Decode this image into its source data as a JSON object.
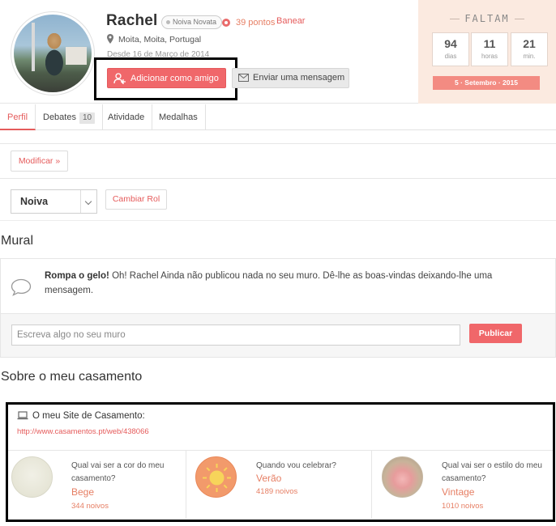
{
  "profile": {
    "name": "Rachel",
    "badge": "Noiva Novata",
    "points": "39 pontos",
    "ban": "Banear",
    "location": "Moita, Moita, Portugal",
    "since": "Desde 16 de Março de 2014"
  },
  "actions": {
    "add_friend": "Adicionar como amigo",
    "send_message": "Enviar uma mensagem"
  },
  "countdown": {
    "title": "FALTAM",
    "days": "94",
    "days_label": "dias",
    "hours": "11",
    "hours_label": "horas",
    "minutes": "21",
    "minutes_label": "min.",
    "date": "5 · Setembro · 2015"
  },
  "tabs": [
    {
      "label": "Perfil"
    },
    {
      "label": "Debates",
      "count": "10"
    },
    {
      "label": "Atividade"
    },
    {
      "label": "Medalhas"
    }
  ],
  "controls": {
    "modify": "Modificar »",
    "role_selected": "Noiva",
    "change_role": "Cambiar Rol"
  },
  "mural": {
    "title": "Mural",
    "notice_bold": "Rompa o gelo!",
    "notice_text": " Oh! Rachel Ainda não publicou nada no seu muro. Dê-lhe as boas-vindas deixando-lhe uma mensagem.",
    "input_placeholder": "Escreva algo no seu muro",
    "publish": "Publicar"
  },
  "wedding": {
    "title": "Sobre o meu casamento",
    "site_label": "O meu Site de Casamento:",
    "site_url": "http://www.casamentos.pt/web/438066",
    "items": [
      {
        "question": "Qual vai ser a cor do meu casamento?",
        "answer": "Bege",
        "count": "344 noivos"
      },
      {
        "question": "Quando vou celebrar?",
        "answer": "Verão",
        "count": "4189 noivos"
      },
      {
        "question": "Qual vai ser o estilo do meu casamento?",
        "answer": "Vintage",
        "count": "1010 noivos"
      }
    ]
  },
  "colors": {
    "accent": "#f0676a",
    "link": "#e55b5b",
    "countdown_bg": "#fbeae0"
  }
}
